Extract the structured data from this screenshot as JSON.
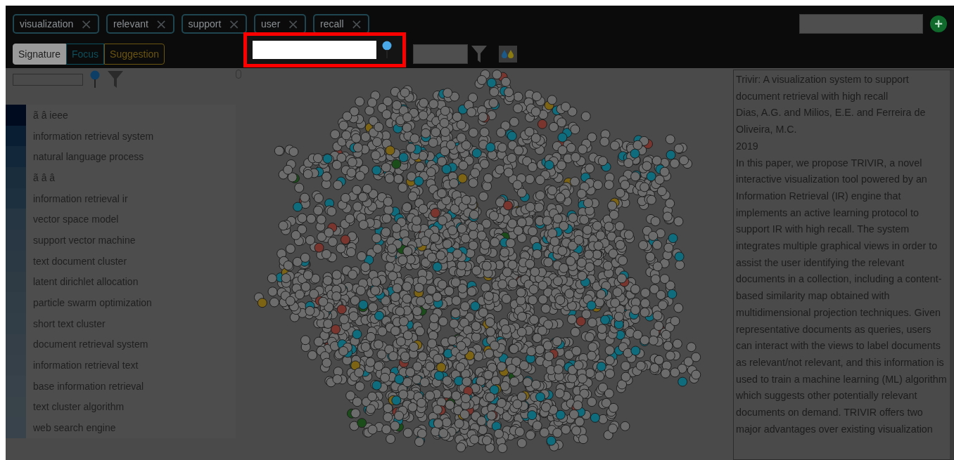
{
  "keywords": [
    {
      "label": "visualization",
      "remove": "×"
    },
    {
      "label": "relevant",
      "remove": "×"
    },
    {
      "label": "support",
      "remove": "×"
    },
    {
      "label": "user",
      "remove": "×"
    },
    {
      "label": "recall",
      "remove": "×"
    }
  ],
  "add_button": "+",
  "modes": [
    {
      "label": "Signature",
      "selected": true,
      "color": "#9a9a9a"
    },
    {
      "label": "Focus",
      "selected": false,
      "color": "#0d4f5c"
    },
    {
      "label": "Suggestion",
      "selected": false,
      "color": "#6b5512"
    }
  ],
  "terms": [
    {
      "label": "ã â ieee",
      "color": "#000b20"
    },
    {
      "label": "information retrieval system",
      "color": "#0a1e33"
    },
    {
      "label": "natural language process",
      "color": "#12283a"
    },
    {
      "label": "ã â â",
      "color": "#1a2d3d"
    },
    {
      "label": "information retrieval ir",
      "color": "#1c3040"
    },
    {
      "label": "vector space model",
      "color": "#263642"
    },
    {
      "label": "support vector machine",
      "color": "#283743"
    },
    {
      "label": "text document cluster",
      "color": "#2b3944"
    },
    {
      "label": "latent dirichlet allocation",
      "color": "#2e3b45"
    },
    {
      "label": "particle swarm optimization",
      "color": "#303c46"
    },
    {
      "label": "short text cluster",
      "color": "#323e47"
    },
    {
      "label": "document retrieval system",
      "color": "#343f48"
    },
    {
      "label": "information retrieval text",
      "color": "#364049"
    },
    {
      "label": "base information retrieval",
      "color": "#37424a"
    },
    {
      "label": "text cluster algorithm",
      "color": "#38434a"
    },
    {
      "label": "web search engine",
      "color": "#39434b"
    }
  ],
  "document": {
    "title": "Trivir: A visualization system to support document retrieval with high recall",
    "authors": "Dias, A.G. and Milios, E.E. and Ferreira de Oliveira, M.C.",
    "year": "2019",
    "abstract": "In this paper, we propose TRIVIR, a novel interactive visualization tool powered by an Information Retrieval (IR) engine that implements an active learning protocol to support IR with high recall. The system integrates multiple graphical views in order to assist the user identifying the relevant documents in a collection, including a content-based similarity map obtained with multidimensional projection techniques. Given representative documents as queries, users can interact with the views to label documents as relevant/not relevant, and this information is used to train a machine learning (ML) algorithm which suggests other potentially relevant documents on demand. TRIVIR offers two major advantages over existing visualization"
  }
}
